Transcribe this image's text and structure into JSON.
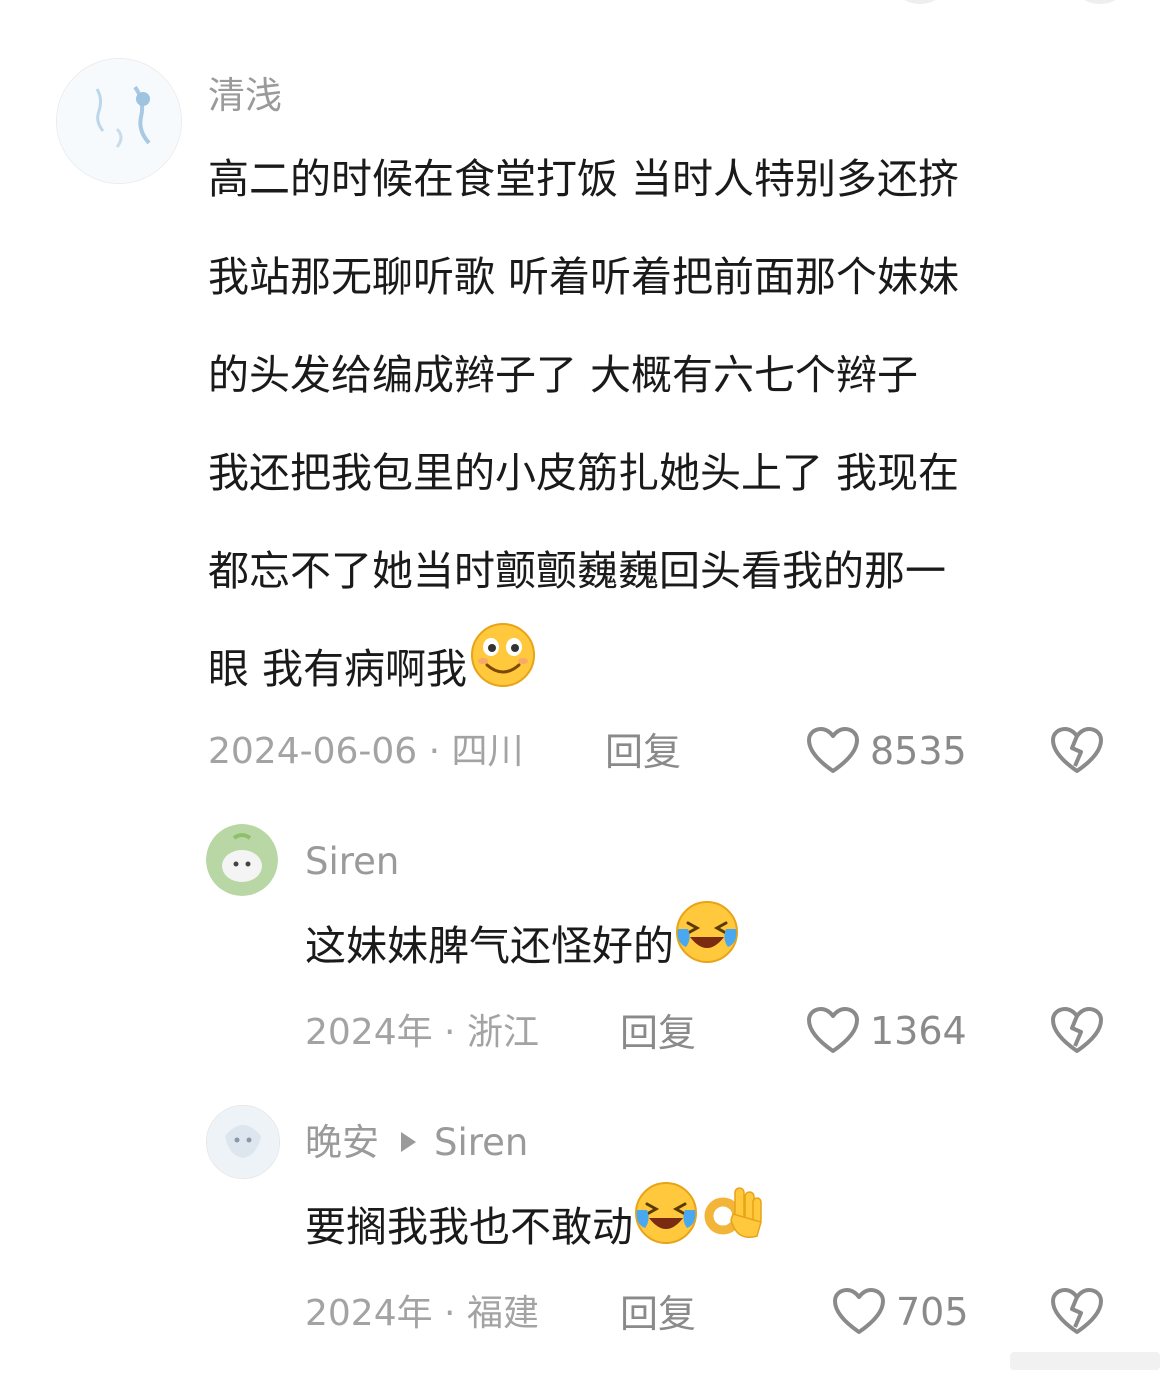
{
  "comments": [
    {
      "author": "清浅",
      "lines": [
        "高二的时候在食堂打饭 当时人特别多还挤",
        "我站那无聊听歌 听着听着把前面那个妹妹",
        "的头发给编成辫子了 大概有六七个辫子",
        "我还把我包里的小皮筋扎她头上了 我现在",
        "都忘不了她当时颤颤巍巍回头看我的那一",
        "眼 我有病啊我"
      ],
      "trailing_emoji": "smile-emoji",
      "date_location": "2024-06-06 · 四川",
      "reply_label": "回复",
      "likes": "8535"
    },
    {
      "author": "Siren",
      "text": "这妹妹脾气还怪好的",
      "trailing_emoji": "laugh-cry-emoji",
      "date_location": "2024年 · 浙江",
      "reply_label": "回复",
      "likes": "1364"
    },
    {
      "author": "晚安",
      "reply_to": "Siren",
      "text": "要搁我我也不敢动",
      "trailing_emoji": [
        "laugh-cry-emoji",
        "ok-hand-emoji"
      ],
      "date_location": "2024年 · 福建",
      "reply_label": "回复",
      "likes": "705"
    }
  ],
  "icons": {
    "like": "heart-outline-icon",
    "dislike": "broken-heart-icon"
  },
  "colors": {
    "text": "#1a1a1a",
    "meta": "#a3a3a3",
    "icon": "#8a8a8a",
    "emoji_yellow": "#ffc83d"
  }
}
